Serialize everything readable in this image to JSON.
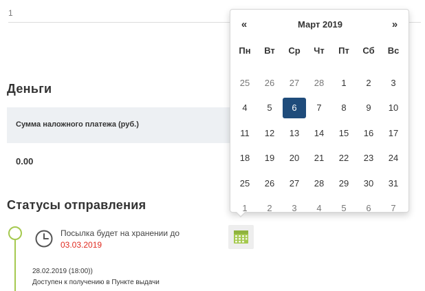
{
  "top": {
    "value": "1"
  },
  "money": {
    "title": "Деньги",
    "column_header": "Сумма наложного платежа (руб.)",
    "value": "0.00"
  },
  "statuses": {
    "title": "Статусы отправления",
    "storage_text": "Посылка будет на хранении до",
    "storage_date": "03.03.2019",
    "event_time": "28.02.2019 (18:00))",
    "event_desc": "Доступен к получению в Пункте выдачи"
  },
  "datepicker": {
    "prev": "«",
    "next": "»",
    "month_title": "Март 2019",
    "weekdays": [
      "Пн",
      "Вт",
      "Ср",
      "Чт",
      "Пт",
      "Сб",
      "Вс"
    ],
    "selected_day": "6",
    "weeks": [
      [
        {
          "d": "25",
          "other": true
        },
        {
          "d": "26",
          "other": true
        },
        {
          "d": "27",
          "other": true
        },
        {
          "d": "28",
          "other": true
        },
        {
          "d": "1"
        },
        {
          "d": "2"
        },
        {
          "d": "3"
        }
      ],
      [
        {
          "d": "4"
        },
        {
          "d": "5"
        },
        {
          "d": "6",
          "active": true
        },
        {
          "d": "7"
        },
        {
          "d": "8"
        },
        {
          "d": "9"
        },
        {
          "d": "10"
        }
      ],
      [
        {
          "d": "11"
        },
        {
          "d": "12"
        },
        {
          "d": "13"
        },
        {
          "d": "14"
        },
        {
          "d": "15"
        },
        {
          "d": "16"
        },
        {
          "d": "17"
        }
      ],
      [
        {
          "d": "18"
        },
        {
          "d": "19"
        },
        {
          "d": "20"
        },
        {
          "d": "21"
        },
        {
          "d": "22"
        },
        {
          "d": "23"
        },
        {
          "d": "24"
        }
      ],
      [
        {
          "d": "25"
        },
        {
          "d": "26"
        },
        {
          "d": "27"
        },
        {
          "d": "28"
        },
        {
          "d": "29"
        },
        {
          "d": "30"
        },
        {
          "d": "31"
        }
      ],
      [
        {
          "d": "1",
          "other": true
        },
        {
          "d": "2",
          "other": true
        },
        {
          "d": "3",
          "other": true
        },
        {
          "d": "4",
          "other": true
        },
        {
          "d": "5",
          "other": true
        },
        {
          "d": "6",
          "other": true
        },
        {
          "d": "7",
          "other": true
        }
      ]
    ]
  },
  "icons": {
    "clock": "clock-icon",
    "calendar": "calendar-icon"
  },
  "colors": {
    "accent_active": "#1f4c7b",
    "timeline": "#a5c94f",
    "date_red": "#e02b20",
    "header_bg": "#edf0f3"
  }
}
